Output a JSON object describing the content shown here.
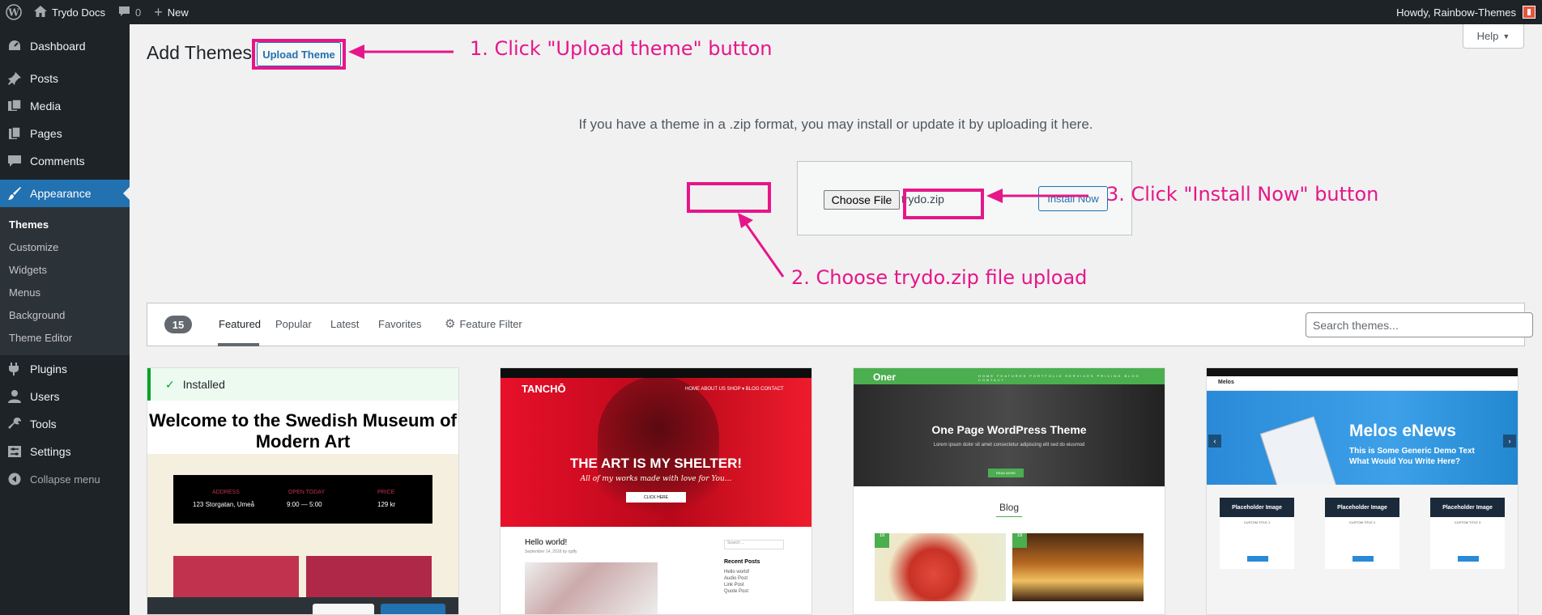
{
  "adminbar": {
    "site_name": "Trydo Docs",
    "comments_count": "0",
    "new_label": "New",
    "howdy": "Howdy, Rainbow-Themes"
  },
  "sidebar": {
    "items": [
      {
        "label": "Dashboard",
        "icon": "dashboard-icon"
      },
      {
        "label": "Posts",
        "icon": "pin-icon"
      },
      {
        "label": "Media",
        "icon": "media-icon"
      },
      {
        "label": "Pages",
        "icon": "pages-icon"
      },
      {
        "label": "Comments",
        "icon": "comments-icon"
      },
      {
        "label": "Appearance",
        "icon": "brush-icon"
      },
      {
        "label": "Plugins",
        "icon": "plug-icon"
      },
      {
        "label": "Users",
        "icon": "user-icon"
      },
      {
        "label": "Tools",
        "icon": "wrench-icon"
      },
      {
        "label": "Settings",
        "icon": "settings-icon"
      }
    ],
    "appearance_sub": [
      "Themes",
      "Customize",
      "Widgets",
      "Menus",
      "Background",
      "Theme Editor"
    ],
    "collapse": "Collapse menu"
  },
  "header": {
    "title": "Add Themes",
    "upload_button": "Upload Theme",
    "help": "Help"
  },
  "upload": {
    "help_text": "If you have a theme in a .zip format, you may install or update it by uploading it here.",
    "choose_file": "Choose File",
    "file_name": "trydo.zip",
    "install_now": "Install Now"
  },
  "annotations": {
    "step1": "1. Click \"Upload theme\" button",
    "step2": "2. Choose trydo.zip file upload",
    "step3": "3. Click \"Install Now\" button",
    "color": "#e6168a"
  },
  "filter": {
    "count": "15",
    "tabs": [
      "Featured",
      "Popular",
      "Latest",
      "Favorites"
    ],
    "feature_filter": "Feature Filter",
    "search_placeholder": "Search themes..."
  },
  "themes": {
    "t1": {
      "installed": "Installed",
      "title": "Welcome to the Swedish Museum of Modern Art",
      "info": [
        {
          "label": "ADDRESS",
          "value": "123 Storgatan, Umeå"
        },
        {
          "label": "OPEN TODAY",
          "value": "9:00 — 5:00"
        },
        {
          "label": "PRICE",
          "value": "129 kr"
        }
      ]
    },
    "t2": {
      "logo": "TANCHŌ",
      "menu": "HOME  ABOUT US  SHOP ▾  BLOG  CONTACT",
      "headline": "THE ART IS MY SHELTER!",
      "subline": "All of my works made with love for You...",
      "button": "CLICK HERE",
      "post_title": "Hello world!",
      "post_meta": "September 14, 2018 by rgdfy",
      "search": "Search ...",
      "recent": "Recent Posts",
      "recent_list": [
        "Hello world!",
        "Audio Post",
        "Link Post",
        "Quote Post"
      ]
    },
    "t3": {
      "logo": "Oner",
      "menu": "HOME  FEATURES  PORTFOLIO  SERVICES  PRICING  BLOG  CONTACT",
      "headline": "One Page WordPress Theme",
      "subline": "Lorem ipsum dolor sit amet consectetur adipiscing elit sed do eiusmod",
      "button": "READ MORE",
      "blog": "Blog",
      "badge1": "18",
      "badge2": "18"
    },
    "t4": {
      "logo": "Melos",
      "headline": "Melos eNews",
      "subline1": "This is Some Generic Demo Text",
      "subline2": "What Would You Write Here?",
      "cards": [
        "Placeholder Image",
        "Placeholder Image",
        "Placeholder Image"
      ],
      "card_text": [
        "CUSTOM TITLE 1",
        "CUSTOM TITLE 2",
        "CUSTOM TITLE 3"
      ]
    }
  }
}
